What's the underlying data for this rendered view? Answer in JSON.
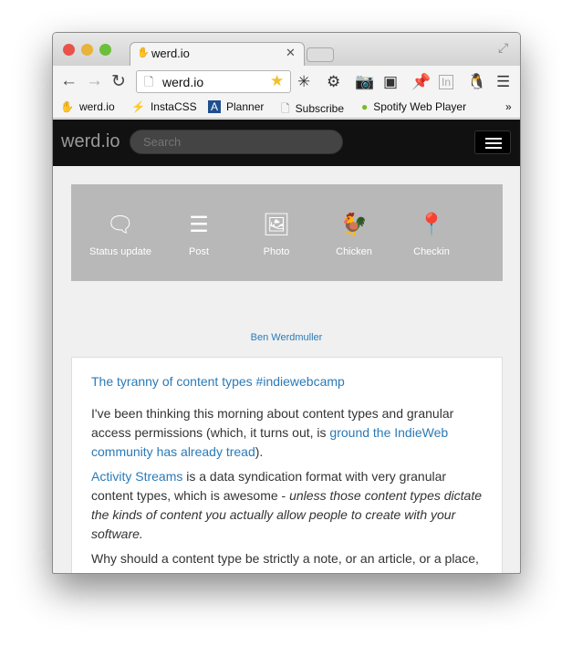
{
  "browser": {
    "tab_title": "werd.io",
    "url": "werd.io",
    "bookmarks": [
      "werd.io",
      "InstaCSS",
      "Planner",
      "Subscribe",
      "Spotify Web Player"
    ],
    "extensions": [
      "asterisk-icon",
      "gear-icon",
      "camera-icon",
      "evernote-icon",
      "pin-icon",
      "linkedin-icon",
      "penguin-icon"
    ]
  },
  "site": {
    "logo": "werd.io",
    "search_placeholder": "Search",
    "content_types": [
      {
        "label": "Status update",
        "icon": "speech-bubble-icon"
      },
      {
        "label": "Post",
        "icon": "align-left-icon"
      },
      {
        "label": "Photo",
        "icon": "image-icon"
      },
      {
        "label": "Chicken",
        "icon": "chicken-icon"
      },
      {
        "label": "Checkin",
        "icon": "map-pin-icon"
      }
    ],
    "author": "Ben Werdmuller",
    "post": {
      "title": "The tyranny of content types #indiewebcamp",
      "p1_a": "I've been thinking this morning about content types and granular access permissions (which, it turns out, is ",
      "p1_link": "ground the IndieWeb community has already tread",
      "p1_b": ").",
      "p2_link": "Activity Streams",
      "p2_a": " is a data syndication format with very granular content types, which is awesome - ",
      "p2_em": "unless those content types dictate the kinds of content you actually allow people to create with your software.",
      "p3": "Why should a content type be strictly a note, or an article, or a place,"
    }
  }
}
